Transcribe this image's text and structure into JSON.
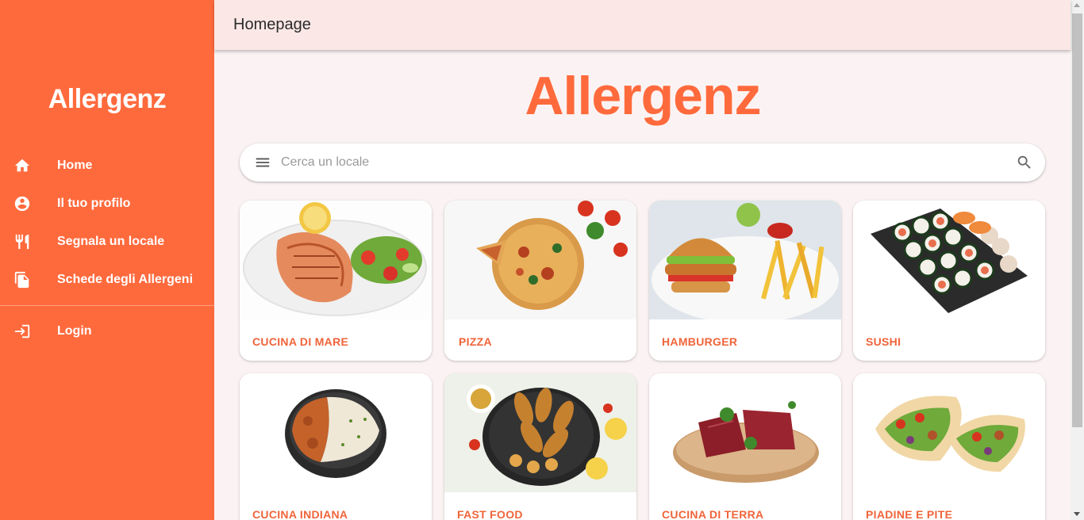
{
  "app": {
    "logo_text": "Allergenz"
  },
  "sidebar": {
    "items": [
      {
        "label": "Home",
        "icon": "home-icon"
      },
      {
        "label": "Il tuo profilo",
        "icon": "account-circle-icon"
      },
      {
        "label": "Segnala un locale",
        "icon": "restaurant-icon"
      },
      {
        "label": "Schede degli Allergeni",
        "icon": "file-copy-icon"
      }
    ],
    "login": {
      "label": "Login",
      "icon": "login-icon"
    }
  },
  "header": {
    "title": "Homepage"
  },
  "search": {
    "placeholder": "Cerca un locale",
    "value": ""
  },
  "categories": [
    {
      "label": "CUCINA DI MARE",
      "image": "grilled-salmon-steak-salad"
    },
    {
      "label": "PIZZA",
      "image": "sliced-pizza-tomatoes"
    },
    {
      "label": "HAMBURGER",
      "image": "burger-with-fries"
    },
    {
      "label": "SUSHI",
      "image": "sushi-platter"
    },
    {
      "label": "CUCINA INDIANA",
      "image": "curry-with-rice-bowl"
    },
    {
      "label": "FAST FOOD",
      "image": "fried-chicken-potatoes-pan"
    },
    {
      "label": "CUCINA DI TERRA",
      "image": "raw-beef-on-wood-board"
    },
    {
      "label": "PIADINE E PITE",
      "image": "stuffed-pita-wraps"
    }
  ],
  "colors": {
    "brand": "#ff6a3d",
    "header_bg": "#fbe8e6",
    "page_bg": "#fbf3f3",
    "card_label": "#f0643a"
  }
}
